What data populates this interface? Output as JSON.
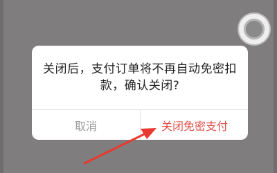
{
  "dialog": {
    "message": "关闭后，支付订单将不再自动免密扣款，确认关闭?",
    "cancel_label": "取消",
    "confirm_label": "关闭免密支付"
  },
  "colors": {
    "overlay": "#7f7d7d",
    "dialog_background": "#ffffff",
    "confirm_text": "#e0504a",
    "cancel_text": "#9a9a9a",
    "annotation_arrow": "#e8392f"
  },
  "icons": {
    "floating_button": "assistive-touch-icon",
    "annotation": "red-arrow-icon"
  }
}
